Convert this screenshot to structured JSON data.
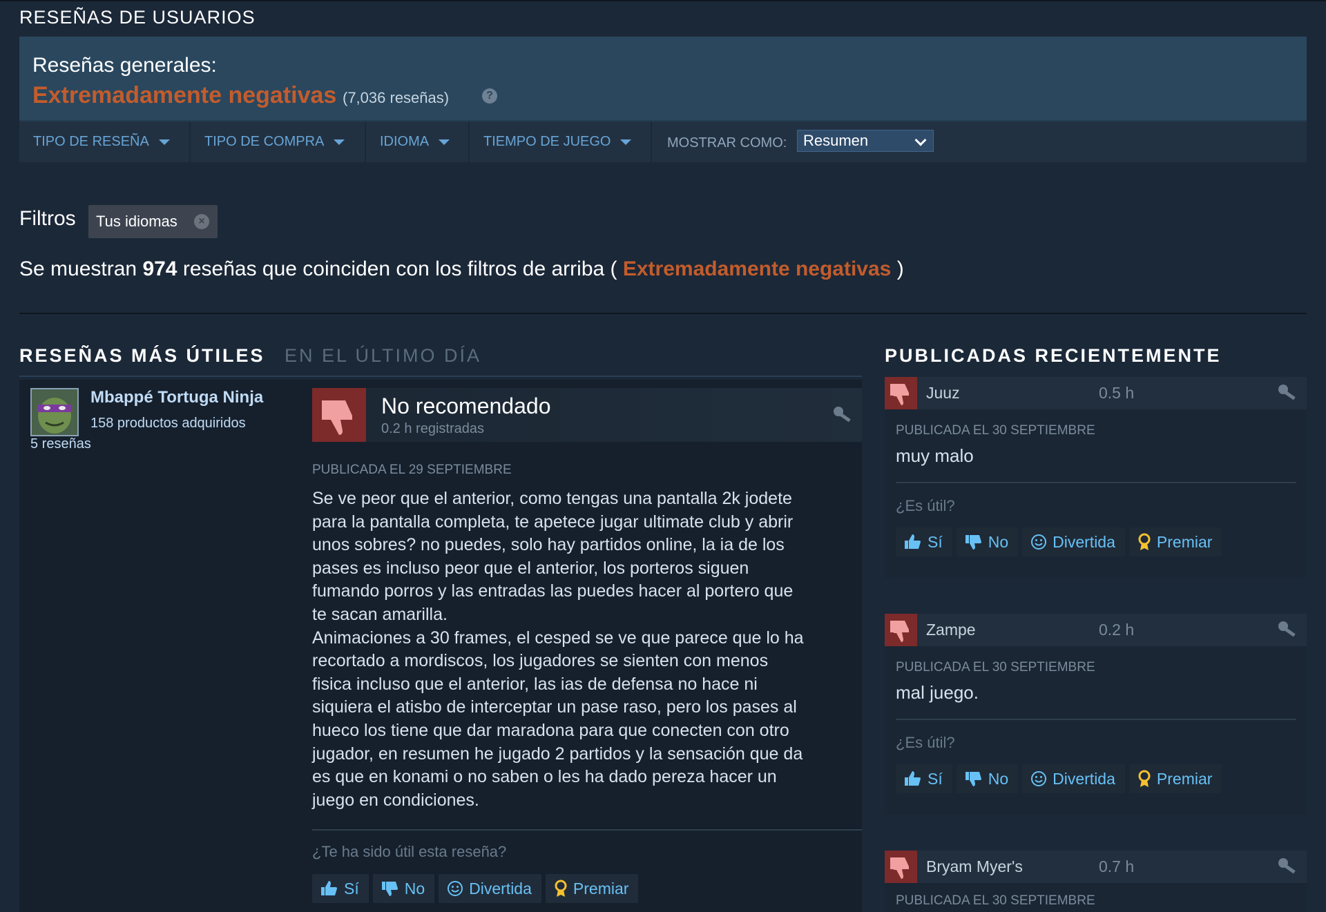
{
  "header": {
    "section_title": "RESEÑAS DE USUARIOS",
    "summary_label": "Reseñas generales:",
    "summary_rating": "Extremadamente negativas",
    "summary_count": "(7,036 reseñas)",
    "help_glyph": "?"
  },
  "filter_bar": {
    "review_type": "TIPO DE RESEÑA",
    "purchase_type": "TIPO DE COMPRA",
    "language": "IDIOMA",
    "playtime": "TIEMPO DE JUEGO",
    "show_as_label": "MOSTRAR COMO:",
    "show_as_value": "Resumen"
  },
  "filters": {
    "label": "Filtros",
    "chip": "Tus idiomas",
    "chip_close": "×"
  },
  "results": {
    "prefix": "Se muestran",
    "count": "974",
    "middle": "reseñas que coinciden con los filtros de arriba (",
    "rating": "Extremadamente negativas",
    "suffix": ")"
  },
  "helpful_section": {
    "title": "RESEÑAS MÁS ÚTILES",
    "subtitle": "EN EL ÚLTIMO DÍA"
  },
  "main_review": {
    "author": "Mbappé Tortuga Ninja",
    "products": "158 productos adquiridos",
    "reviews": "5 reseñas",
    "verdict": "No recomendado",
    "hours": "0.2 h registradas",
    "posted": "PUBLICADA EL 29 SEPTIEMBRE",
    "body": "Se ve peor que el anterior, como tengas una pantalla 2k jodete\npara la pantalla completa, te apetece jugar ultimate club y abrir\nunos sobres? no puedes, solo hay partidos online, la ia de los\npases es incluso peor que el anterior, los porteros siguen\nfumando porros y las entradas las puedes hacer al portero que\nte sacan amarilla.\nAnimaciones a 30 frames, el cesped se ve que parece que lo ha\nrecortado a mordiscos, los jugadores se sienten con menos\nfisica incluso que el anterior, las ias de defensa no hace ni\nsiquiera el atisbo de interceptar un pase raso, pero los pases al\nhueco los tiene que dar maradona para que conecten con otro\njugador, en resumen he jugado 2 partidos y la sensación que da\nes que en konami o no saben o les ha dado pereza hacer un\njuego en condiciones.",
    "helpful_question": "¿Te ha sido útil esta reseña?",
    "btn_yes": "Sí",
    "btn_no": "No",
    "btn_funny": "Divertida",
    "btn_award": "Premiar"
  },
  "recent_section": {
    "title": "PUBLICADAS RECIENTEMENTE"
  },
  "recent_reviews": [
    {
      "name": "Juuz",
      "hours": "0.5 h",
      "posted": "PUBLICADA EL 30 SEPTIEMBRE",
      "text": "muy malo",
      "question": "¿Es útil?",
      "yes": "Sí",
      "no": "No",
      "funny": "Divertida",
      "award": "Premiar"
    },
    {
      "name": "Zampe",
      "hours": "0.2 h",
      "posted": "PUBLICADA EL 30 SEPTIEMBRE",
      "text": "mal juego.",
      "question": "¿Es útil?",
      "yes": "Sí",
      "no": "No",
      "funny": "Divertida",
      "award": "Premiar"
    },
    {
      "name": "Bryam Myer's",
      "hours": "0.7 h",
      "posted": "PUBLICADA EL 30 SEPTIEMBRE"
    }
  ],
  "colors": {
    "background": "#1b2838",
    "negative": "#c35c2c",
    "link": "#67c1f5",
    "thumb_down_bg": "#7d2a2a"
  },
  "icons": [
    "help-icon",
    "caret-down-icon",
    "chevron-down-icon",
    "close-icon",
    "thumbs-down-icon",
    "key-icon",
    "thumbs-up-icon",
    "smiley-icon",
    "award-icon"
  ]
}
